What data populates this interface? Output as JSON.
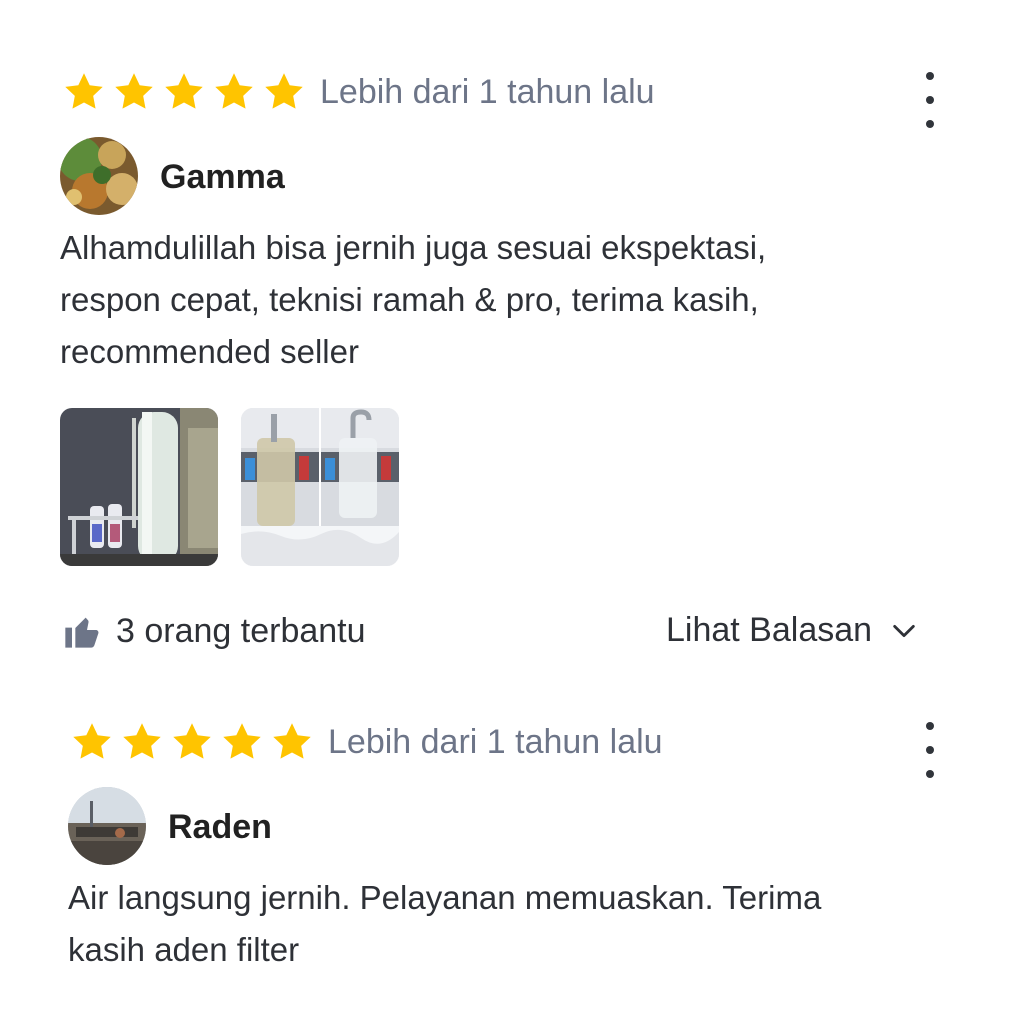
{
  "reviews": [
    {
      "rating": 5,
      "date": "Lebih dari 1 tahun lalu",
      "reviewer": "Gamma",
      "text_lines": [
        "Alhamdulillah bisa jernih juga sesuai ekspektasi,",
        "respon cepat, teknisi ramah & pro, terima kasih,",
        "recommended seller"
      ],
      "photos": [
        "filter-tank-photo",
        "water-comparison-photo"
      ],
      "helpful": "3 orang terbantu",
      "replies_label": "Lihat Balasan"
    },
    {
      "rating": 5,
      "date": "Lebih dari 1 tahun lalu",
      "reviewer": "Raden",
      "text_lines": [
        "Air langsung jernih. Pelayanan memuaskan. Terima",
        "kasih aden filter"
      ]
    }
  ],
  "colors": {
    "star": "#FFC400",
    "muted_text": "#6D7588",
    "primary_text": "#2E3137"
  },
  "icons": [
    "star-icon",
    "more-vertical-icon",
    "thumbs-up-icon",
    "chevron-down-icon"
  ]
}
